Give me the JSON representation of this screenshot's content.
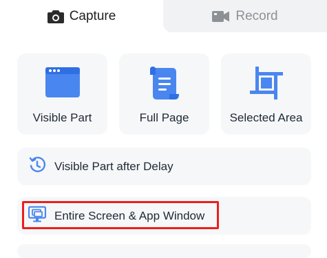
{
  "tabs": [
    {
      "label": "Capture",
      "active": true,
      "icon": "camera-icon"
    },
    {
      "label": "Record",
      "active": false,
      "icon": "video-camera-icon"
    }
  ],
  "cards": [
    {
      "label": "Visible Part",
      "icon": "browser-window-icon"
    },
    {
      "label": "Full Page",
      "icon": "scroll-page-icon"
    },
    {
      "label": "Selected Area",
      "icon": "crop-icon"
    }
  ],
  "rows": [
    {
      "label": "Visible Part after Delay",
      "icon": "delay-timer-icon"
    },
    {
      "label": "Entire Screen & App Window",
      "icon": "monitor-icon",
      "highlighted": true
    }
  ],
  "colors": {
    "accent": "#4a86f0",
    "highlight_border": "#ee1c1c",
    "card_bg": "#f6f7f8",
    "inactive_tab_bg": "#f1f2f4"
  }
}
